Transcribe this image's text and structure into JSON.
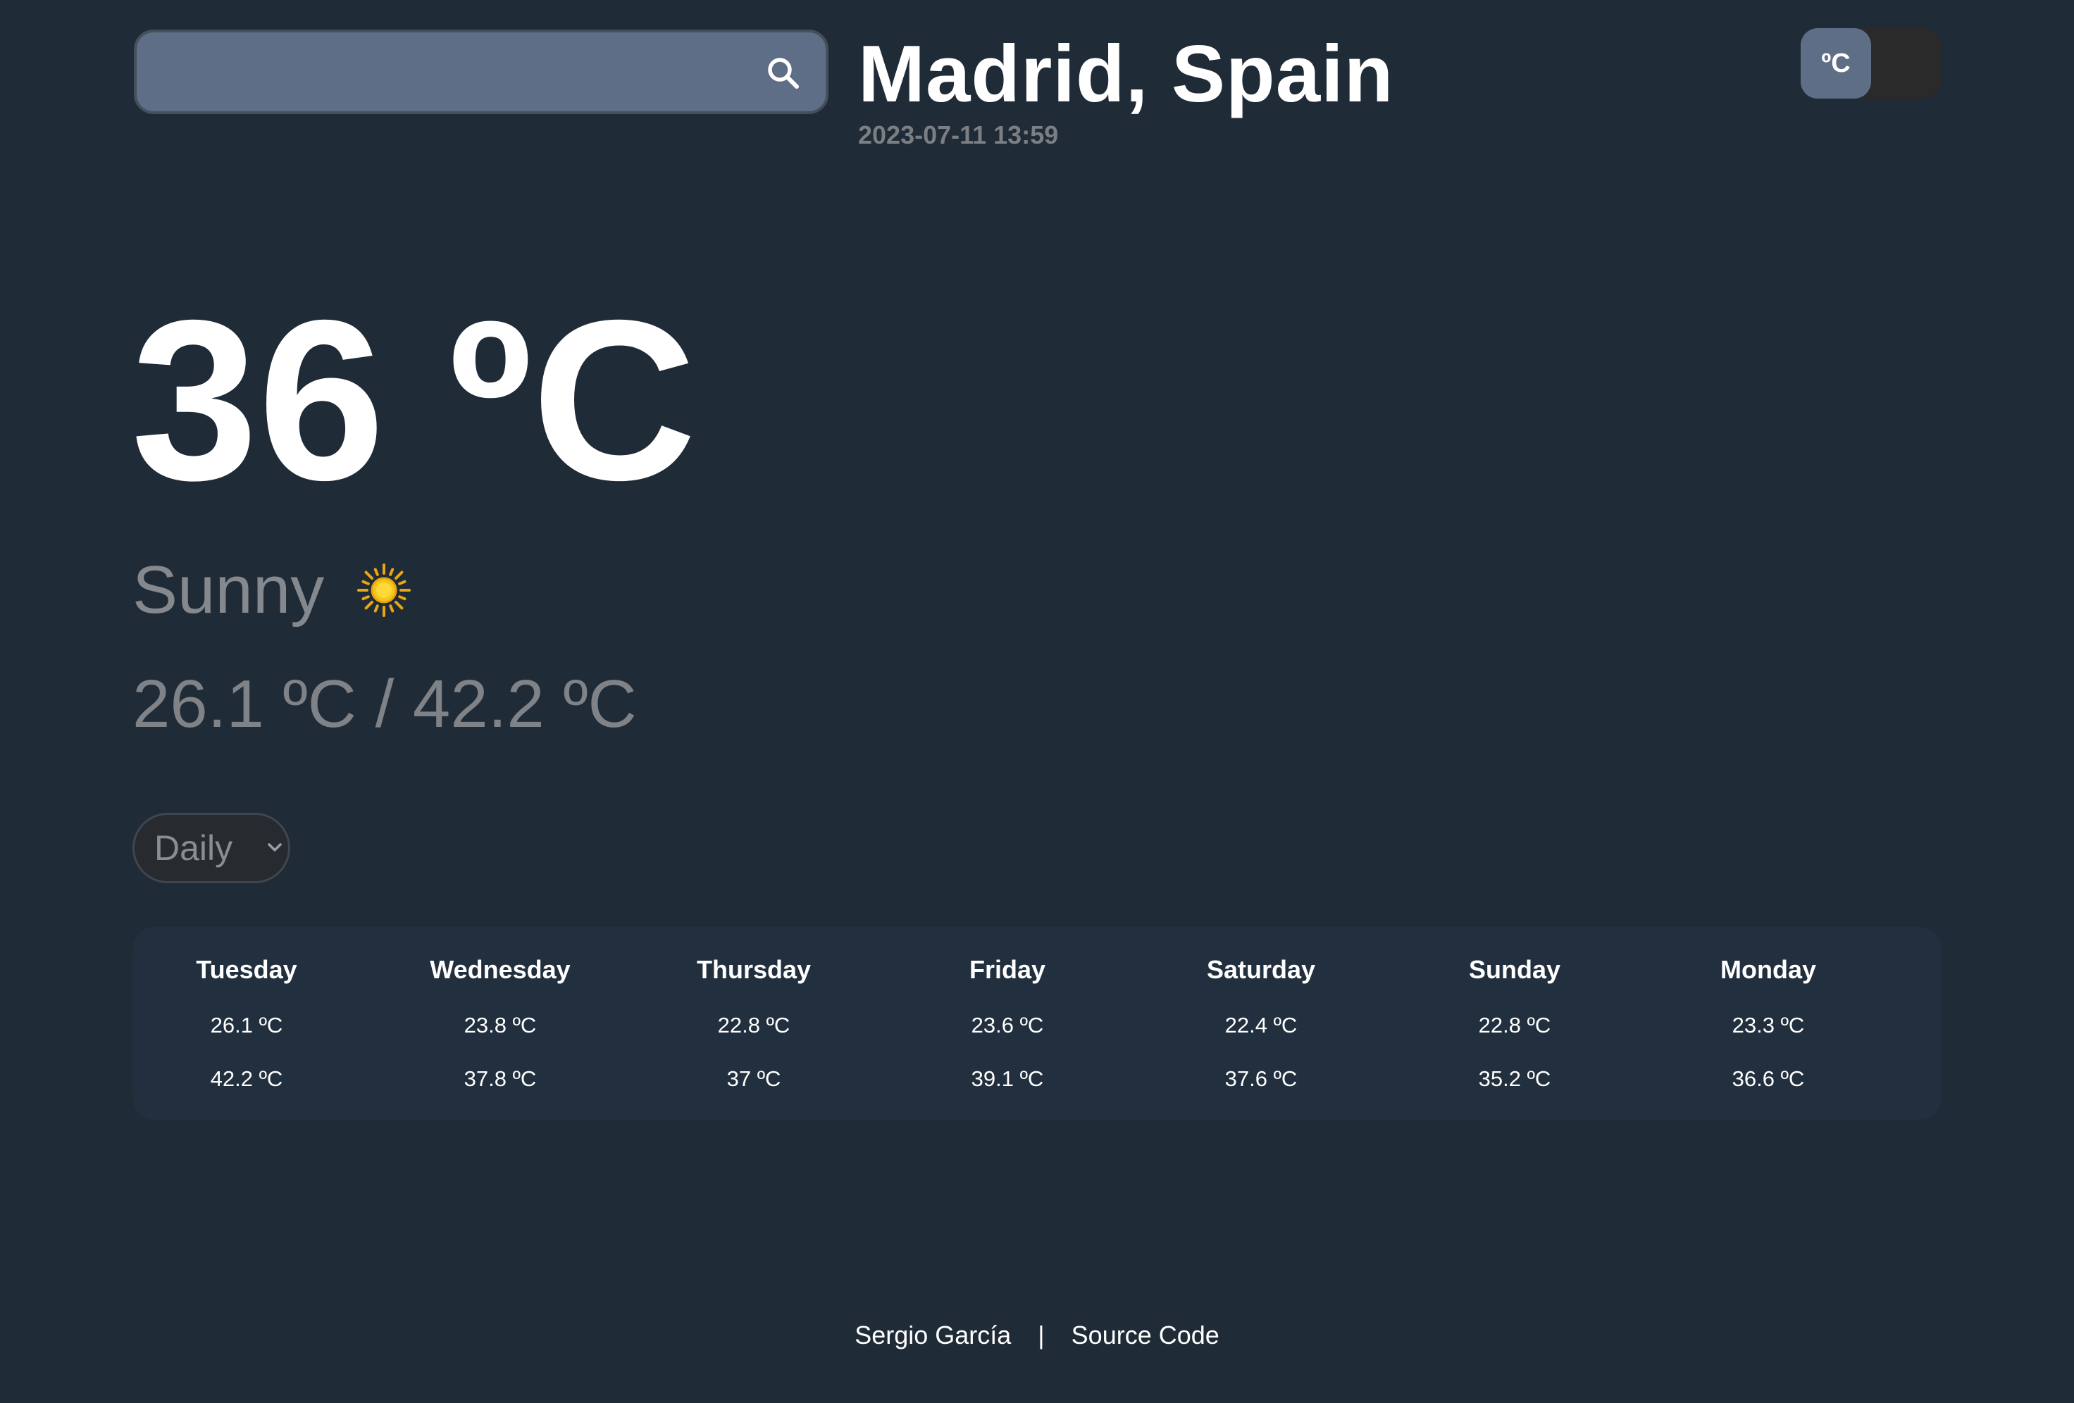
{
  "search": {
    "value": "",
    "placeholder": ""
  },
  "location": {
    "title": "Madrid, Spain",
    "datetime": "2023-07-11 13:59"
  },
  "unit_toggle": {
    "label": "ºC"
  },
  "current": {
    "temperature": "36 ºC",
    "condition": "Sunny",
    "condition_icon": "sun-icon",
    "min_max": "26.1 ºC / 42.2 ºC"
  },
  "period_select": {
    "selected": "Daily"
  },
  "forecast": [
    {
      "day": "Tuesday",
      "min": "26.1 ºC",
      "max": "42.2 ºC"
    },
    {
      "day": "Wednesday",
      "min": "23.8 ºC",
      "max": "37.8 ºC"
    },
    {
      "day": "Thursday",
      "min": "22.8 ºC",
      "max": "37 ºC"
    },
    {
      "day": "Friday",
      "min": "23.6 ºC",
      "max": "39.1 ºC"
    },
    {
      "day": "Saturday",
      "min": "22.4 ºC",
      "max": "37.6 ºC"
    },
    {
      "day": "Sunday",
      "min": "22.8 ºC",
      "max": "35.2 ºC"
    },
    {
      "day": "Monday",
      "min": "23.3 ºC",
      "max": "36.6 ºC"
    }
  ],
  "footer": {
    "author": "Sergio García",
    "separator": "|",
    "source_link": "Source Code"
  },
  "colors": {
    "background": "#1f2b37",
    "panel": "#212f3e",
    "search_field": "#5e6e86",
    "muted_text": "#85888c",
    "sun": "#f5c518"
  }
}
